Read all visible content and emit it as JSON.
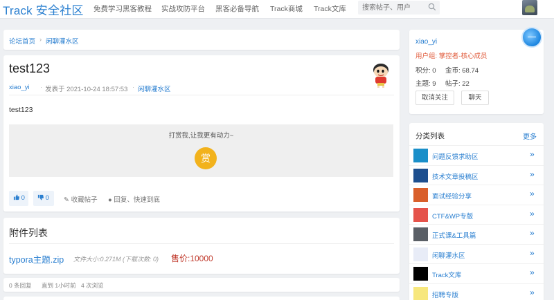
{
  "header": {
    "logo": "Track 安全社区",
    "nav": [
      {
        "label": "免费学习黑客教程"
      },
      {
        "label": "实战攻防平台"
      },
      {
        "label": "黑客必备导航"
      },
      {
        "label": "Track商城"
      },
      {
        "label": "Track文库"
      }
    ],
    "search_placeholder": "搜索帖子、用户"
  },
  "breadcrumb": {
    "home": "论坛首页",
    "separator": "›",
    "forum": "闲聊灌水区"
  },
  "post": {
    "title": "test123",
    "author": "xiao_yi",
    "time": "发表于 2021-10-24 18:57:53",
    "forum": "闲聊灌水区",
    "dot": "·",
    "body": "test123",
    "reward_text": "打赏我,让我更有动力~",
    "reward_button": "赏",
    "actions": {
      "like": "0",
      "dislike": "0",
      "favorite": "收藏帖子",
      "reply": "回复、快速到底"
    }
  },
  "attachments": {
    "title": "附件列表",
    "file_name": "typora主题.zip",
    "file_meta": "文件大小:0.271M (下载次数: 0)",
    "price": "售价:10000"
  },
  "stats": {
    "replies": "0 条回复",
    "updated": "直到 1小时前",
    "views": "4 次浏览"
  },
  "user_card": {
    "name": "xiao_yi",
    "group": "用户组: 掌控者-核心成员",
    "points": "积分: 0",
    "coins": "金币: 68.74",
    "topics": "主题: 9",
    "posts": "帖子: 22",
    "unfollow_button": "取消关注",
    "chat_button": "聊天"
  },
  "categories": {
    "title": "分类列表",
    "more": "更多",
    "arrow": "»",
    "items": [
      {
        "label": "问题反馈求助区",
        "color": "#1a8fc9"
      },
      {
        "label": "技术文章投稿区",
        "color": "#1d4f8f"
      },
      {
        "label": "面试经验分享",
        "color": "#d95f2b"
      },
      {
        "label": "CTF&WP专版",
        "color": "#e5534b"
      },
      {
        "label": "正式课&工具篇",
        "color": "#5a5f66"
      },
      {
        "label": "闲聊灌水区",
        "color": "#e8ecf7"
      },
      {
        "label": "Track文库",
        "color": "#000000"
      },
      {
        "label": "招聘专版",
        "color": "#f7e77d"
      }
    ]
  }
}
